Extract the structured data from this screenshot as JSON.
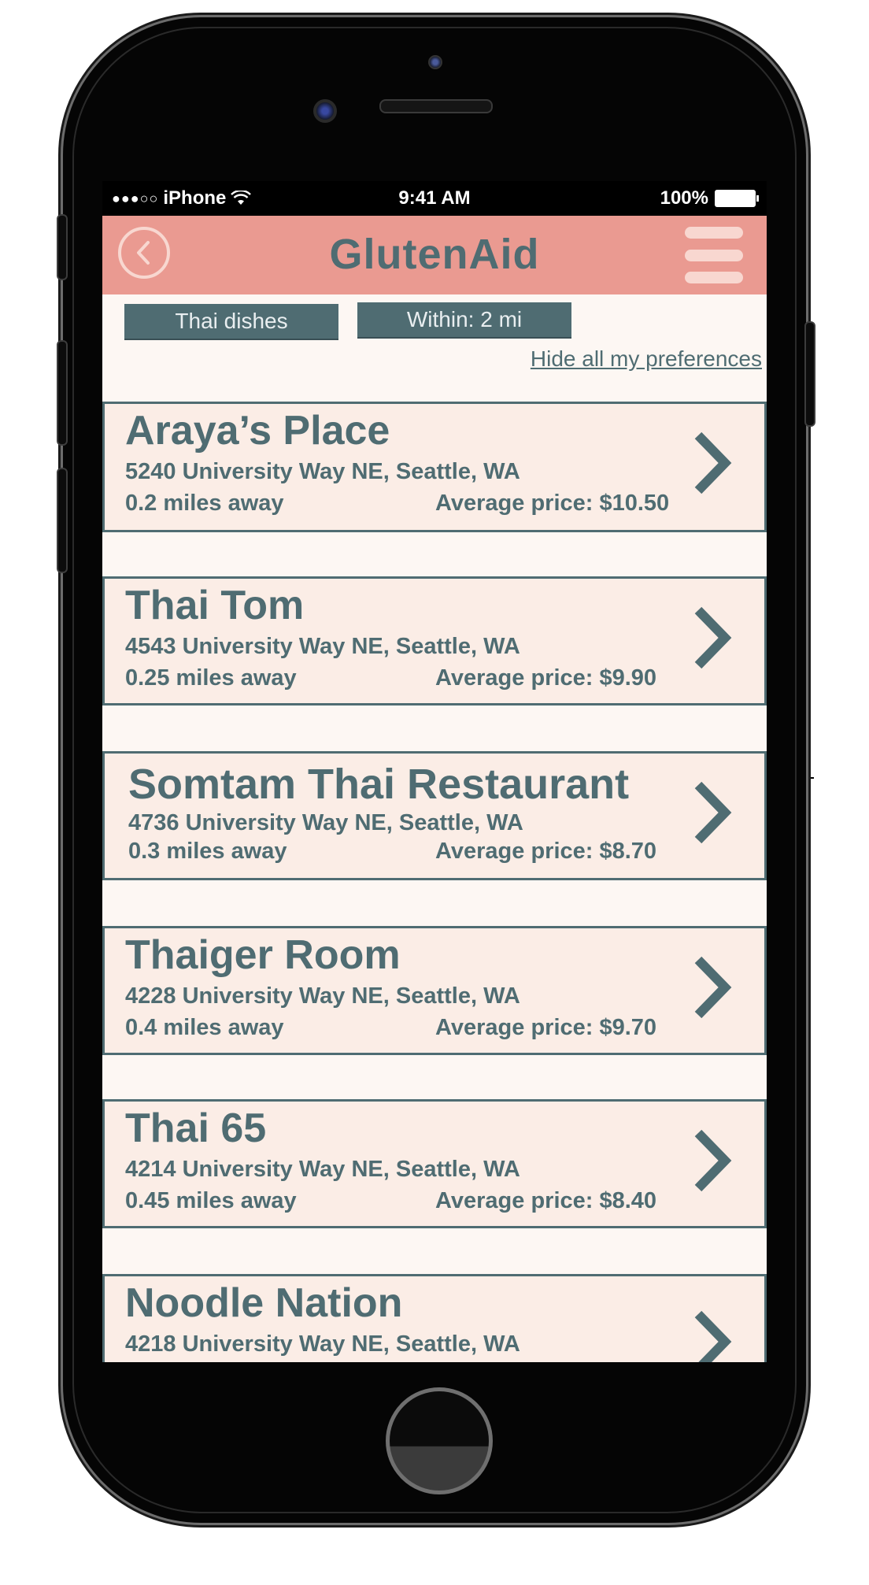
{
  "status_bar": {
    "carrier": "iPhone",
    "signal": "●●●○○",
    "time": "9:41 AM",
    "battery": "100%"
  },
  "header": {
    "title": "GlutenAid",
    "back_icon": "chevron-left-circle-icon",
    "menu_icon": "hamburger-menu-icon"
  },
  "filters": {
    "cuisine": "Thai dishes",
    "distance": "Within: 2 mi",
    "hide_link": "Hide all my preferences"
  },
  "restaurants": [
    {
      "name": "Araya’s Place",
      "address": "5240 University Way NE, Seattle, WA",
      "distance": "0.2 miles away",
      "price": "Average price: $10.50"
    },
    {
      "name": "Thai Tom",
      "address": "4543 University Way NE, Seattle, WA",
      "distance": "0.25 miles away",
      "price": "Average price: $9.90"
    },
    {
      "name": "Somtam Thai Restaurant",
      "address": "4736 University Way NE, Seattle, WA",
      "distance": "0.3 miles away",
      "price": "Average price: $8.70"
    },
    {
      "name": "Thaiger Room",
      "address": "4228 University Way NE, Seattle, WA",
      "distance": "0.4 miles away",
      "price": "Average price: $9.70"
    },
    {
      "name": "Thai 65",
      "address": "4214 University Way NE, Seattle, WA",
      "distance": "0.45 miles away",
      "price": "Average price: $8.40"
    },
    {
      "name": "Noodle Nation",
      "address": "4218 University Way NE, Seattle, WA"
    }
  ],
  "colors": {
    "header_bg": "#ea9a91",
    "accent": "#4f6c72",
    "card_bg": "#fbede6",
    "screen_bg": "#fdf7f3"
  }
}
